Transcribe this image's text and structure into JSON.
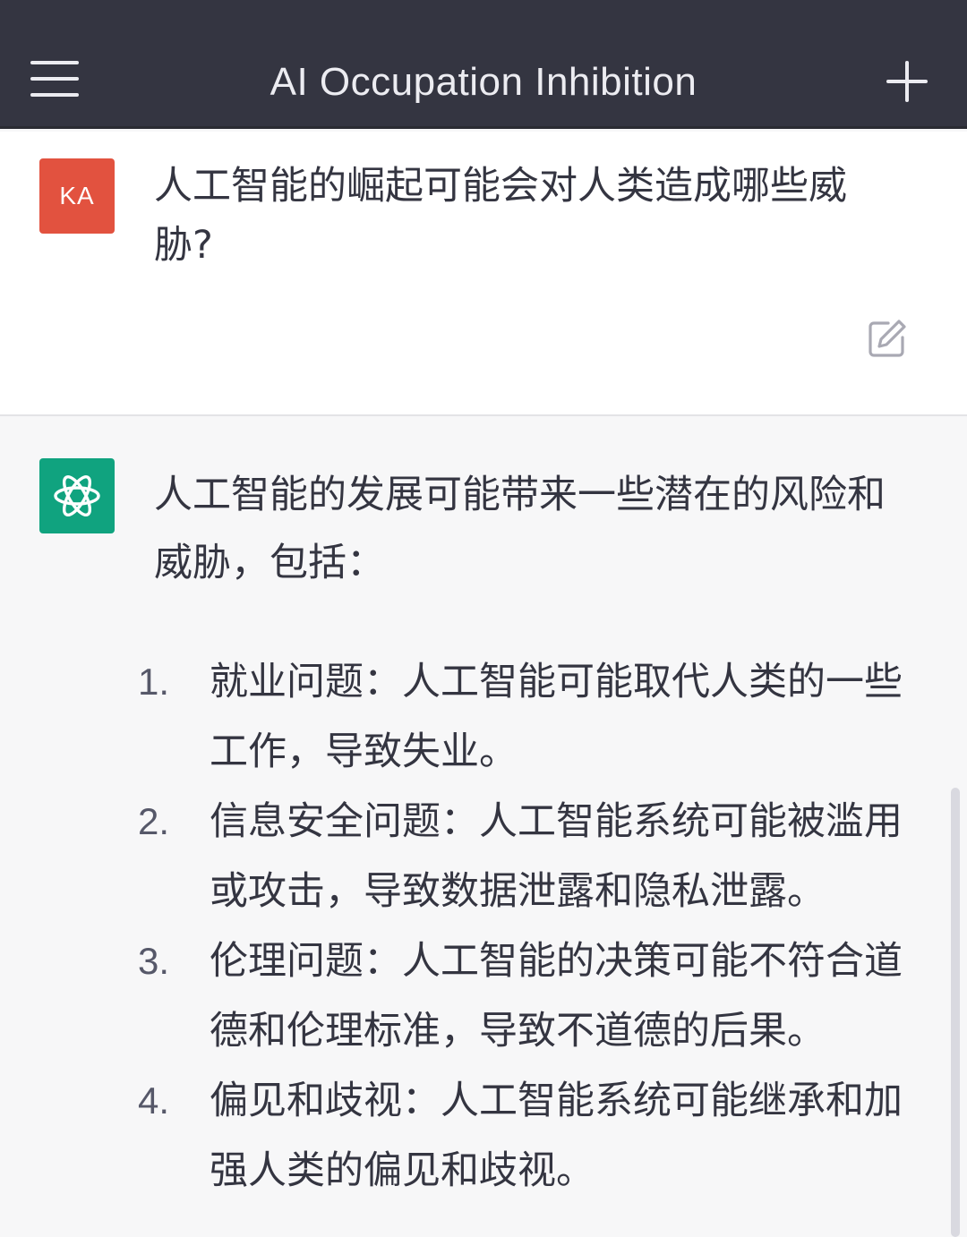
{
  "header": {
    "title": "AI Occupation Inhibition",
    "menu_icon": "hamburger-menu-icon",
    "new_chat_icon": "plus-icon"
  },
  "user_message": {
    "avatar_initials": "KA",
    "avatar_color": "#e2523f",
    "text": "人工智能的崛起可能会对人类造成哪些威胁?",
    "edit_icon": "edit-icon"
  },
  "assistant_message": {
    "avatar_icon": "openai-logo-icon",
    "avatar_color": "#10a37f",
    "intro": "人工智能的发展可能带来一些潜在的风险和威胁，包括：",
    "items": [
      {
        "num": "1.",
        "text": "就业问题：人工智能可能取代人类的一些工作，导致失业。"
      },
      {
        "num": "2.",
        "text": "信息安全问题：人工智能系统可能被滥用或攻击，导致数据泄露和隐私泄露。"
      },
      {
        "num": "3.",
        "text": "伦理问题：人工智能的决策可能不符合道德和伦理标准，导致不道德的后果。"
      },
      {
        "num": "4.",
        "text": "偏见和歧视：人工智能系统可能继承和加强人类的偏见和歧视。"
      }
    ]
  }
}
